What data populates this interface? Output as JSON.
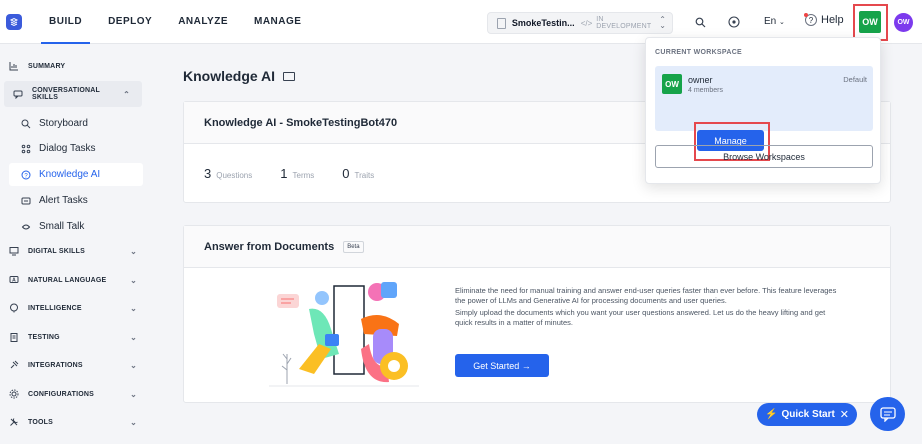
{
  "nav": {
    "tabs": [
      {
        "label": "BUILD",
        "active": true
      },
      {
        "label": "DEPLOY"
      },
      {
        "label": "ANALYZE"
      },
      {
        "label": "MANAGE"
      }
    ],
    "bot": {
      "name": "SmokeTestin...",
      "code_icon": "</>",
      "status": "IN DEVELOPMENT"
    },
    "language": "En",
    "help": "Help",
    "workspace_avatar": "OW",
    "user_avatar": "OW"
  },
  "sidebar": {
    "summary": "SUMMARY",
    "conversational": "CONVERSATIONAL SKILLS",
    "sub": [
      "Storyboard",
      "Dialog Tasks",
      "Knowledge AI",
      "Alert Tasks",
      "Small Talk"
    ],
    "sections": [
      "DIGITAL SKILLS",
      "NATURAL LANGUAGE",
      "INTELLIGENCE",
      "TESTING",
      "INTEGRATIONS",
      "CONFIGURATIONS",
      "TOOLS"
    ]
  },
  "main": {
    "title": "Knowledge AI",
    "card_title": "Knowledge AI - SmokeTestingBot470",
    "stats": [
      {
        "n": "3",
        "label": "Questions"
      },
      {
        "n": "1",
        "label": "Terms"
      },
      {
        "n": "0",
        "label": "Traits"
      }
    ],
    "docs_title": "Answer from Documents",
    "beta": "Beta",
    "desc1": "Eliminate the need for manual training and answer end-user queries faster than ever before. This feature leverages the power of LLMs and Generative AI for processing documents and user queries.",
    "desc2": "Simply upload the documents which you want your user questions answered. Let us do the heavy lifting and get quick results in a matter of minutes.",
    "get_started": "Get Started →"
  },
  "workspace": {
    "caption": "CURRENT WORKSPACE",
    "avatar": "OW",
    "owner": "owner",
    "members": "4 members",
    "default": "Default",
    "manage": "Manage",
    "browse": "Browse Workspaces"
  },
  "quick_start": {
    "label": "Quick Start",
    "close": "✕"
  }
}
